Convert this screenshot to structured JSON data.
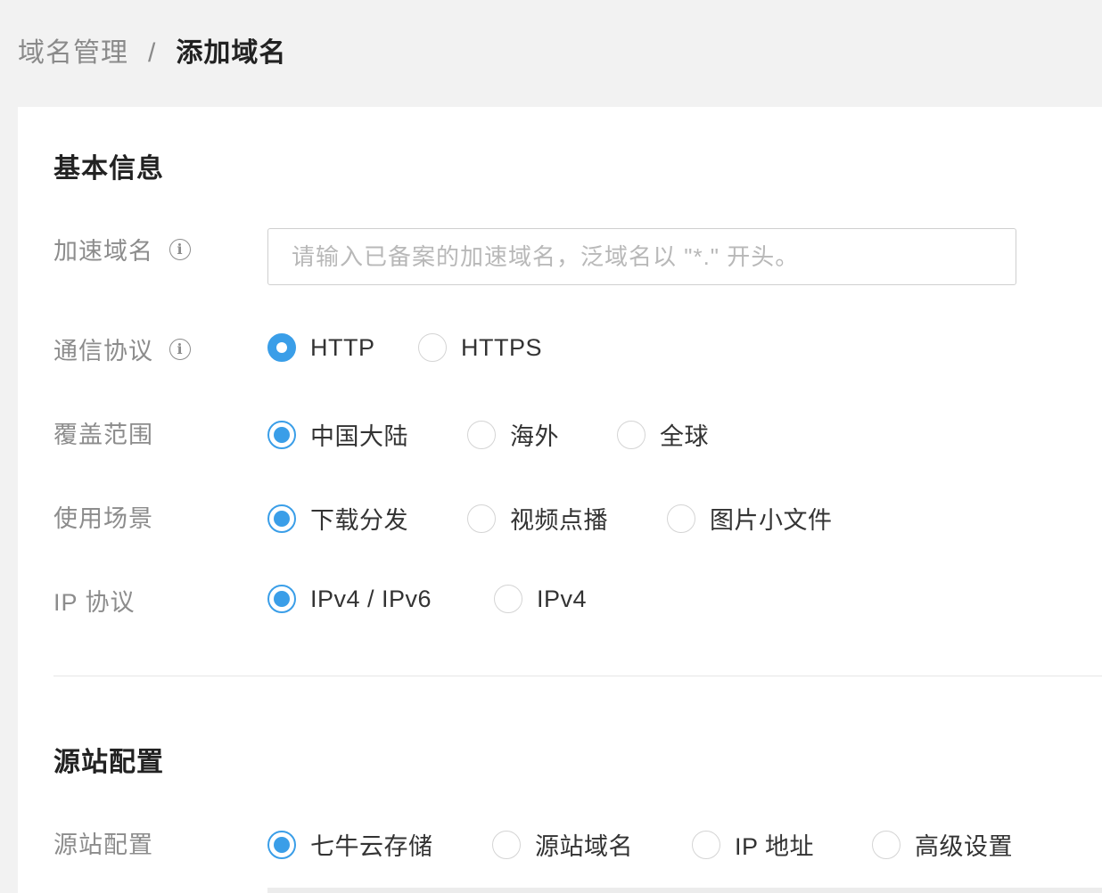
{
  "breadcrumb": {
    "parent": "域名管理",
    "separator": "/",
    "current": "添加域名"
  },
  "basic_info": {
    "title": "基本信息",
    "accel_domain": {
      "label": "加速域名",
      "input_value": "",
      "placeholder": "请输入已备案的加速域名，泛域名以 \"*.\" 开头。"
    },
    "protocol": {
      "label": "通信协议",
      "options": [
        "HTTP",
        "HTTPS"
      ],
      "selected": "HTTP"
    },
    "coverage": {
      "label": "覆盖范围",
      "options": [
        "中国大陆",
        "海外",
        "全球"
      ],
      "selected": "中国大陆"
    },
    "scenario": {
      "label": "使用场景",
      "options": [
        "下载分发",
        "视频点播",
        "图片小文件"
      ],
      "selected": "下载分发"
    },
    "ip_protocol": {
      "label": "IP 协议",
      "options": [
        "IPv4 / IPv6",
        "IPv4"
      ],
      "selected": "IPv4 / IPv6"
    }
  },
  "origin": {
    "title": "源站配置",
    "origin_type": {
      "label": "源站配置",
      "options": [
        "七牛云存储",
        "源站域名",
        "IP 地址",
        "高级设置"
      ],
      "selected": "七牛云存储"
    }
  },
  "icons": {
    "info": "info-circle-icon",
    "info_glyph": "i"
  },
  "colors": {
    "accent": "#3a9ee8",
    "background": "#f2f2f2",
    "card": "#ffffff"
  }
}
